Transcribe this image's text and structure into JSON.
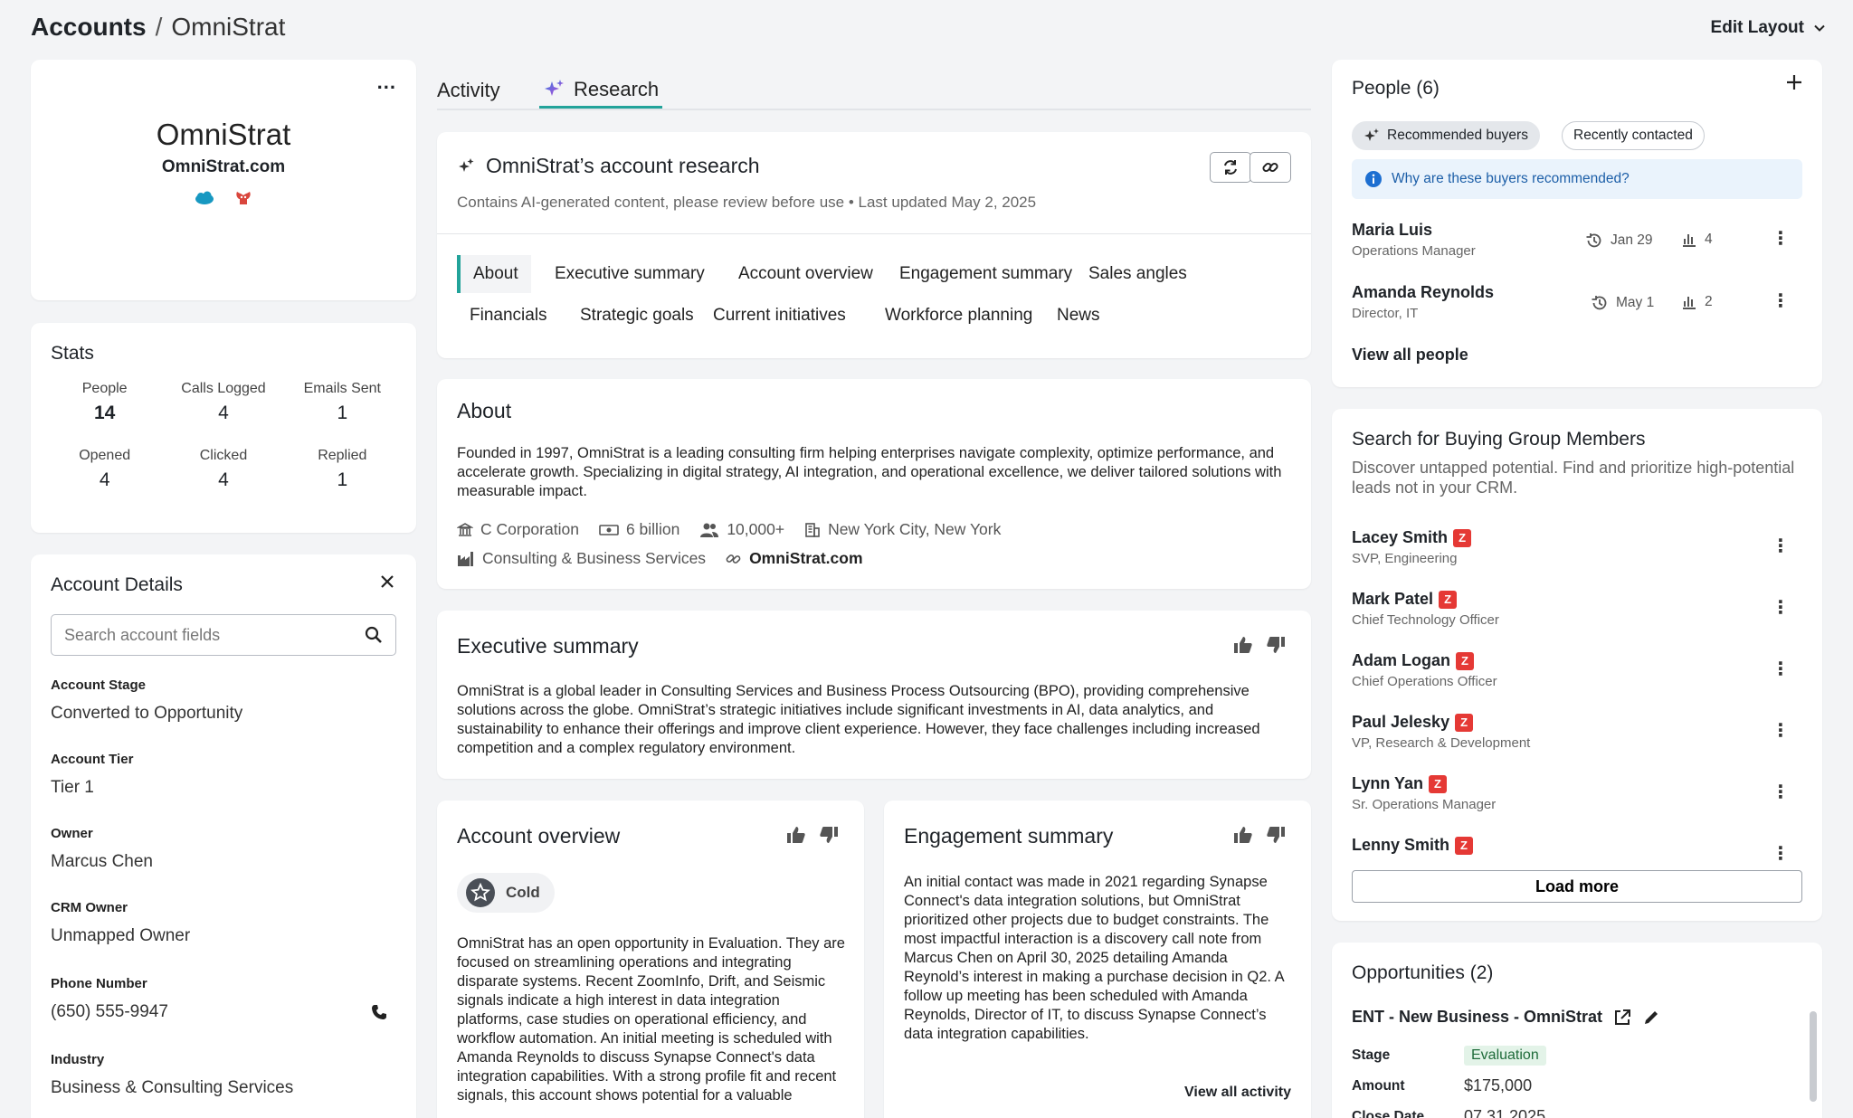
{
  "header": {
    "breadcrumb_root": "Accounts",
    "breadcrumb_sep": "/",
    "breadcrumb_current": "OmniStrat",
    "edit_layout": "Edit Layout"
  },
  "profile": {
    "name": "OmniStrat",
    "domain": "OmniStrat.com",
    "menu": "...",
    "integrations": [
      "salesforce-icon",
      "outreach-icon"
    ]
  },
  "stats": {
    "title": "Stats",
    "items": [
      {
        "label": "People",
        "value": "14"
      },
      {
        "label": "Calls Logged",
        "value": "4"
      },
      {
        "label": "Emails Sent",
        "value": "1"
      },
      {
        "label": "Opened",
        "value": "4"
      },
      {
        "label": "Clicked",
        "value": "4"
      },
      {
        "label": "Replied",
        "value": "1"
      }
    ]
  },
  "details": {
    "title": "Account Details",
    "search_placeholder": "Search account fields",
    "fields": [
      {
        "label": "Account Stage",
        "value": "Converted to Opportunity"
      },
      {
        "label": "Account Tier",
        "value": "Tier 1"
      },
      {
        "label": "Owner",
        "value": "Marcus Chen"
      },
      {
        "label": "CRM Owner",
        "value": "Unmapped Owner"
      },
      {
        "label": "Phone Number",
        "value": "(650) 555-9947"
      },
      {
        "label": "Industry",
        "value": "Business & Consulting Services"
      }
    ]
  },
  "tabs": {
    "activity": "Activity",
    "research": "Research"
  },
  "research": {
    "title": "OmniStrat’s account research",
    "subtitle": "Contains AI-generated content, please review before use • Last updated May 2, 2025",
    "sections": [
      "About",
      "Executive summary",
      "Account overview",
      "Engagement summary",
      "Sales angles",
      "Financials",
      "Strategic goals",
      "Current initiatives",
      "Workforce planning",
      "News"
    ]
  },
  "about": {
    "title": "About",
    "text": "Founded in 1997, OmniStrat is a leading consulting firm helping enterprises navigate complexity, optimize performance, and accelerate growth. Specializing in digital strategy, AI integration, and operational excellence, we deliver tailored solutions with measurable impact.",
    "corp_type": "C Corporation",
    "revenue": "6 billion",
    "employees": "10,000+",
    "location": "New York City, New York",
    "industry": "Consulting & Business Services",
    "website": "OmniStrat.com"
  },
  "exec": {
    "title": "Executive summary",
    "text": "OmniStrat is a global leader in Consulting Services and Business Process Outsourcing (BPO), providing comprehensive solutions across the globe. OmniStrat’s strategic initiatives include significant investments in AI, data analytics, and sustainability to enhance their offerings and improve client experience. However, they face challenges including increased competition and a complex regulatory environment."
  },
  "overview": {
    "title": "Account overview",
    "temperature": "Cold",
    "text": "OmniStrat has an open opportunity in Evaluation. They are focused on streamlining operations and integrating disparate systems. Recent ZoomInfo, Drift, and Seismic signals indicate a high interest in data integration platforms, case studies on operational efficiency, and workflow automation. An initial meeting is scheduled with Amanda Reynolds to discuss Synapse Connect's data integration capabilities. With a strong profile fit and recent signals, this account shows potential for a valuable"
  },
  "engage": {
    "title": "Engagement summary",
    "text": "An initial contact was made in 2021 regarding Synapse Connect's data integration solutions, but OmniStrat prioritized other projects due to budget constraints. The most impactful interaction is a discovery call note from Marcus Chen on April 30, 2025 detailing Amanda Reynold’s interest in making a purchase decision in Q2. A follow up meeting has been scheduled with Amanda Reynolds, Director of IT, to discuss Synapse Connect’s data integration capabilities.",
    "view_all": "View all activity"
  },
  "people": {
    "title": "People (6)",
    "chip_recommended": "Recommended buyers",
    "chip_recent": "Recently contacted",
    "why": "Why are these buyers recommended?",
    "list": [
      {
        "name": "Maria Luis",
        "title": "Operations Manager",
        "date": "Jan 29",
        "count": "4"
      },
      {
        "name": "Amanda Reynolds",
        "title": "Director, IT",
        "date": "May 1",
        "count": "2"
      }
    ],
    "view_all": "View all people"
  },
  "bgm": {
    "title": "Search for Buying Group Members",
    "desc": "Discover untapped potential. Find and prioritize high-potential leads not in your CRM.",
    "members": [
      {
        "name": "Lacey Smith",
        "title": "SVP, Engineering"
      },
      {
        "name": "Mark Patel",
        "title": "Chief Technology Officer"
      },
      {
        "name": "Adam Logan",
        "title": "Chief Operations Officer"
      },
      {
        "name": "Paul Jelesky",
        "title": "VP, Research & Development"
      },
      {
        "name": "Lynn Yan",
        "title": "Sr. Operations Manager"
      },
      {
        "name": "Lenny Smith",
        "title": ""
      }
    ],
    "load_more": "Load more"
  },
  "opps": {
    "title": "Opportunities (2)",
    "name": "ENT - New Business -  OmniStrat",
    "stage_label": "Stage",
    "stage_value": "Evaluation",
    "amount_label": "Amount",
    "amount_value": "$175,000",
    "close_label": "Close Date",
    "close_value": "07.31.2025"
  },
  "colors": {
    "accent": "#22a39a",
    "zoominfo": "#e53935",
    "info_blue": "#1d5fa8",
    "eval_green": "#1f6b3a"
  }
}
